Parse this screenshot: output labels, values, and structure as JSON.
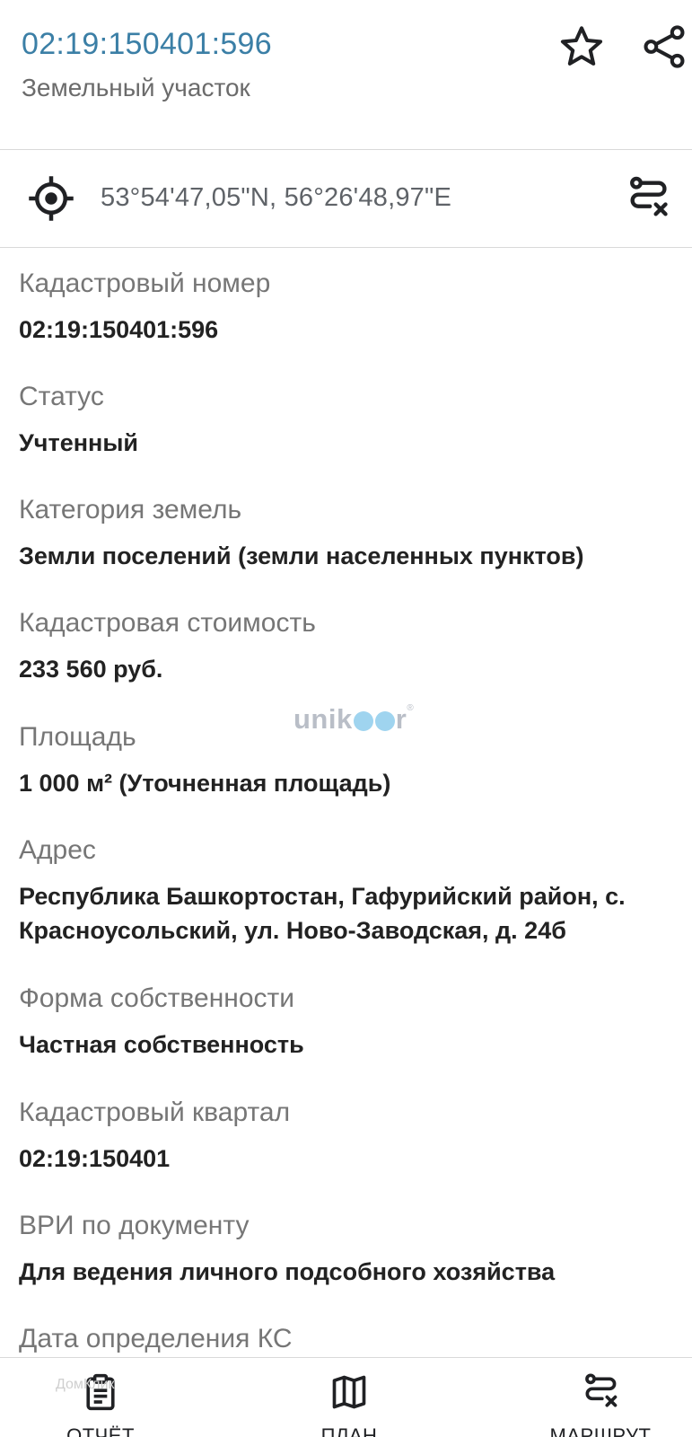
{
  "header": {
    "title": "02:19:150401:596",
    "subtitle": "Земельный участок",
    "favorite_icon": "star-outline-icon",
    "share_icon": "share-icon"
  },
  "location": {
    "icon": "gps-target-icon",
    "coordinates": "53°54'47,05\"N, 56°26'48,97\"E",
    "route_icon": "route-clear-icon"
  },
  "fields": [
    {
      "label": "Кадастровый номер",
      "value": "02:19:150401:596"
    },
    {
      "label": "Статус",
      "value": "Учтенный"
    },
    {
      "label": "Категория земель",
      "value": "Земли поселений (земли населенных пунктов)"
    },
    {
      "label": "Кадастровая стоимость",
      "value": "233 560 руб."
    },
    {
      "label": "Площадь",
      "value": "1 000 м² (Уточненная площадь)"
    },
    {
      "label": "Адрес",
      "value": "Республика Башкортостан, Гафурийский район, с. Красноусольский, ул. Ново-Заводская, д. 24б"
    },
    {
      "label": "Форма собственности",
      "value": "Частная собственность"
    },
    {
      "label": "Кадастровый квартал",
      "value": "02:19:150401"
    },
    {
      "label": "ВРИ по документу",
      "value": "Для ведения личного подсобного хозяйства"
    },
    {
      "label": "Дата определения КС",
      "value": ""
    }
  ],
  "watermark": {
    "pre": "unik",
    "post": "r",
    "mark": "®"
  },
  "bottom_nav": [
    {
      "label": "ОТЧЁТ",
      "icon": "clipboard-report-icon"
    },
    {
      "label": "ПЛАН",
      "icon": "map-icon"
    },
    {
      "label": "МАРШРУТ",
      "icon": "route-clear-icon"
    }
  ],
  "domclick_watermark": "ДомКлик",
  "colors": {
    "title": "#3b7fa6",
    "label": "#767676",
    "value": "#222222",
    "divider": "#d9d9d9"
  }
}
